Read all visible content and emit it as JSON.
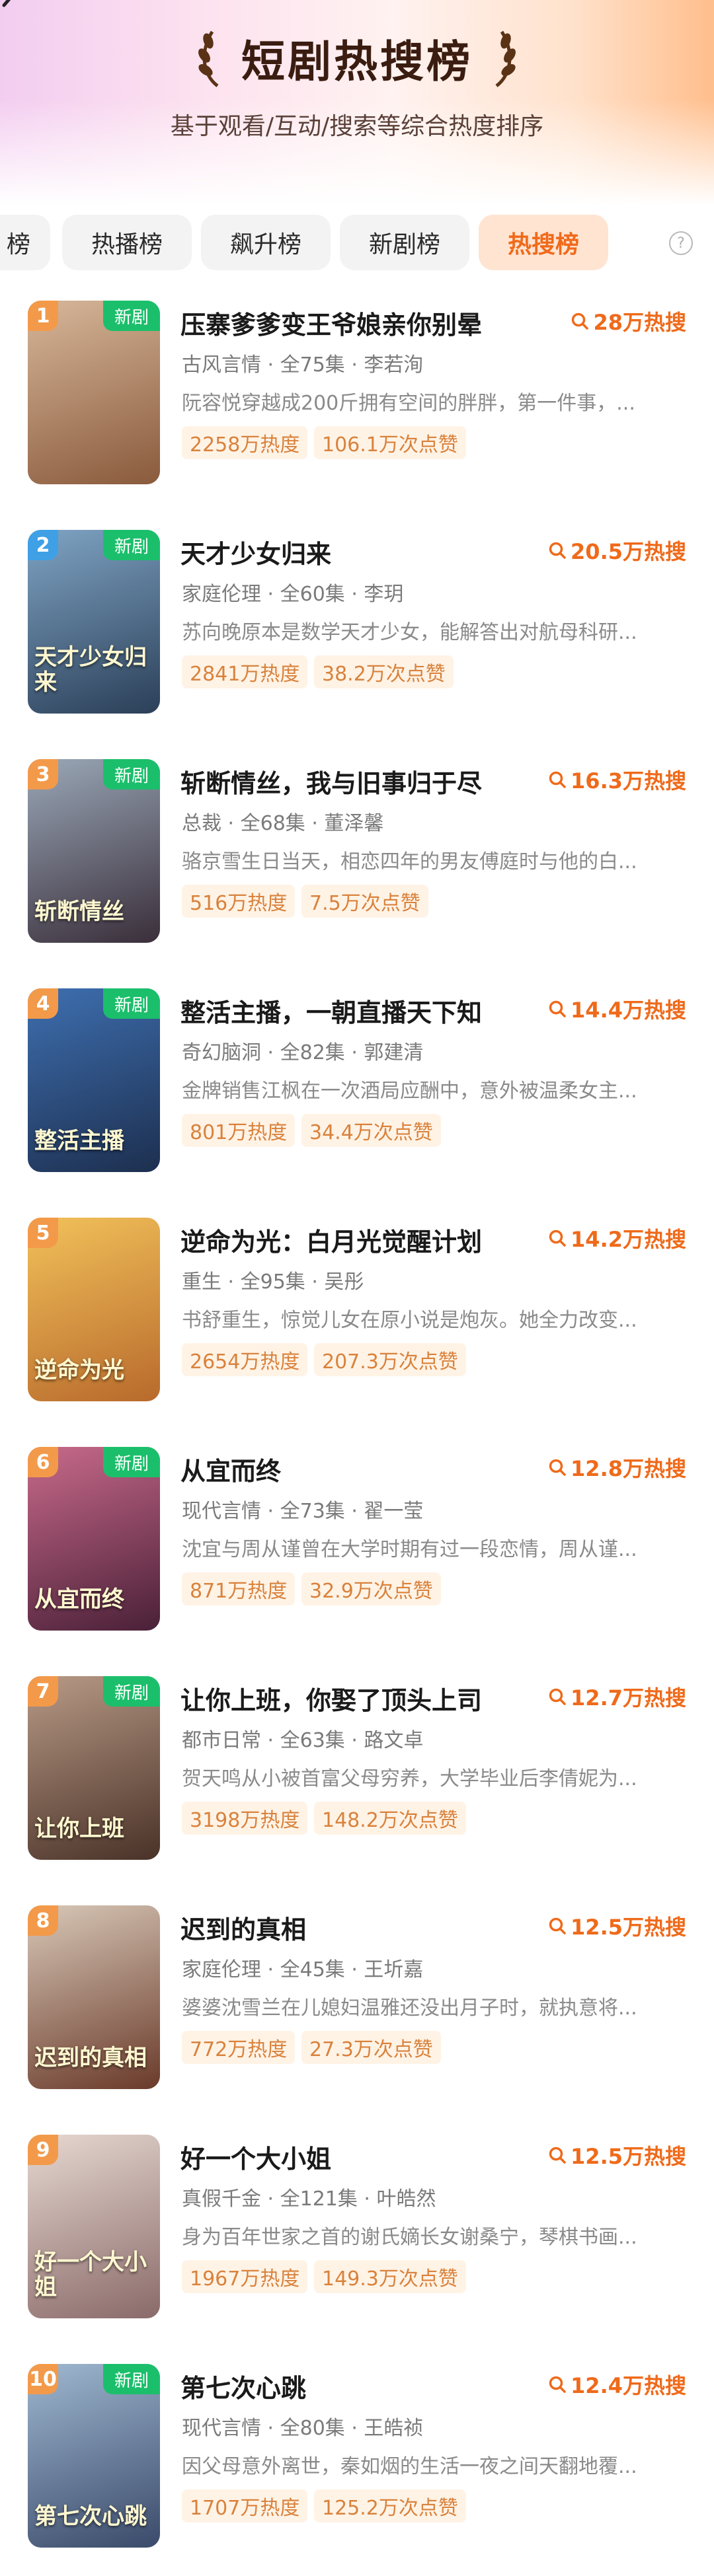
{
  "header": {
    "title": "短剧热搜榜",
    "subtitle": "基于观看/互动/搜索等综合热度排序"
  },
  "tabs": [
    {
      "label": "榜"
    },
    {
      "label": "热播榜"
    },
    {
      "label": "飙升榜"
    },
    {
      "label": "新剧榜"
    },
    {
      "label": "热搜榜"
    }
  ],
  "help_glyph": "?",
  "new_badge_label": "新剧",
  "items": [
    {
      "rank": "1",
      "name": "压寨爹爹变王爷娘亲你别晕",
      "heat": "28万热搜",
      "meta": "古风言情 · 全75集 · 李若洵",
      "desc": "阮容悦穿越成200斤拥有空间的胖胖，第一件事，...",
      "stat_heat": "2258万热度",
      "stat_likes": "106.1万次点赞",
      "cover_title": "",
      "new": true
    },
    {
      "rank": "2",
      "name": "天才少女归来",
      "heat": "20.5万热搜",
      "meta": "家庭伦理 · 全60集 · 李玥",
      "desc": "苏向晚原本是数学天才少女，能解答出对航母科研...",
      "stat_heat": "2841万热度",
      "stat_likes": "38.2万次点赞",
      "cover_title": "天才少女归来",
      "new": true
    },
    {
      "rank": "3",
      "name": "斩断情丝，我与旧事归于尽",
      "heat": "16.3万热搜",
      "meta": "总裁 · 全68集 · 董泽馨",
      "desc": "骆京雪生日当天，相恋四年的男友傅庭时与他的白...",
      "stat_heat": "516万热度",
      "stat_likes": "7.5万次点赞",
      "cover_title": "斩断情丝",
      "new": true
    },
    {
      "rank": "4",
      "name": "整活主播，一朝直播天下知",
      "heat": "14.4万热搜",
      "meta": "奇幻脑洞 · 全82集 · 郭建清",
      "desc": "金牌销售江枫在一次酒局应酬中，意外被温柔女主...",
      "stat_heat": "801万热度",
      "stat_likes": "34.4万次点赞",
      "cover_title": "整活主播",
      "new": true
    },
    {
      "rank": "5",
      "name": "逆命为光：白月光觉醒计划",
      "heat": "14.2万热搜",
      "meta": "重生 · 全95集 · 吴彤",
      "desc": "书舒重生，惊觉儿女在原小说是炮灰。她全力改变...",
      "stat_heat": "2654万热度",
      "stat_likes": "207.3万次点赞",
      "cover_title": "逆命为光",
      "new": false
    },
    {
      "rank": "6",
      "name": "从宜而终",
      "heat": "12.8万热搜",
      "meta": "现代言情 · 全73集 · 翟一莹",
      "desc": "沈宜与周从谨曾在大学时期有过一段恋情，周从谨...",
      "stat_heat": "871万热度",
      "stat_likes": "32.9万次点赞",
      "cover_title": "从宜而终",
      "new": true
    },
    {
      "rank": "7",
      "name": "让你上班，你娶了顶头上司",
      "heat": "12.7万热搜",
      "meta": "都市日常 · 全63集 · 路文卓",
      "desc": "贺天鸣从小被首富父母穷养，大学毕业后李倩妮为...",
      "stat_heat": "3198万热度",
      "stat_likes": "148.2万次点赞",
      "cover_title": "让你上班",
      "new": true
    },
    {
      "rank": "8",
      "name": "迟到的真相",
      "heat": "12.5万热搜",
      "meta": "家庭伦理 · 全45集 · 王圻嘉",
      "desc": "婆婆沈雪兰在儿媳妇温雅还没出月子时，就执意将...",
      "stat_heat": "772万热度",
      "stat_likes": "27.3万次点赞",
      "cover_title": "迟到的真相",
      "new": false
    },
    {
      "rank": "9",
      "name": "好一个大小姐",
      "heat": "12.5万热搜",
      "meta": "真假千金 · 全121集 · 叶皓然",
      "desc": "身为百年世家之首的谢氏嫡长女谢桑宁，琴棋书画...",
      "stat_heat": "1967万热度",
      "stat_likes": "149.3万次点赞",
      "cover_title": "好一个大小姐",
      "new": false
    },
    {
      "rank": "10",
      "name": "第七次心跳",
      "heat": "12.4万热搜",
      "meta": "现代言情 · 全80集 · 王皓祯",
      "desc": "因父母意外离世，秦如烟的生活一夜之间天翻地覆...",
      "stat_heat": "1707万热度",
      "stat_likes": "125.2万次点赞",
      "cover_title": "第七次心跳",
      "new": true
    }
  ],
  "colors": {
    "accent": "#ef6a1a",
    "new_badge": "#1bbf6b",
    "rank_badge": "#f29a4a",
    "rank_badge_2": "#3fa0e6",
    "stat_bg": "#fff3e6"
  }
}
